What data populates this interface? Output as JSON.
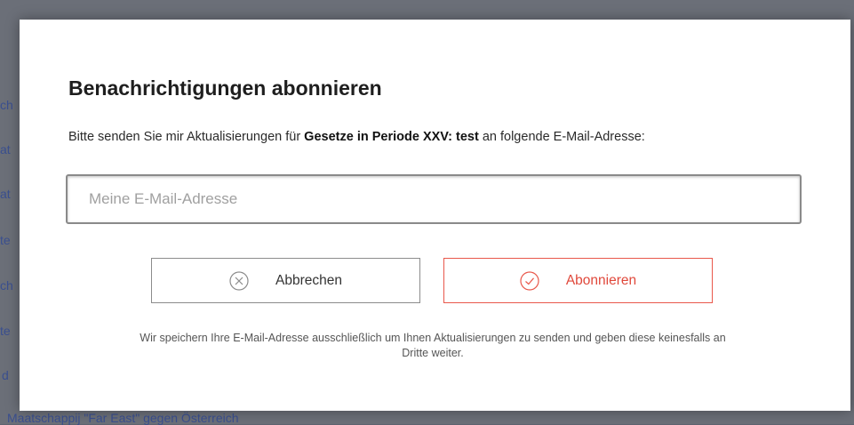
{
  "background": {
    "left_fragments": [
      "ch",
      "at",
      "at",
      "te",
      "ch",
      "te",
      "d"
    ],
    "bottom_link": "Maatschappij \"Far East\" gegen Österreich"
  },
  "modal": {
    "title": "Benachrichtigungen abonnieren",
    "intro_before": "Bitte senden Sie mir Aktualisierungen für ",
    "intro_bold": "Gesetze in Periode XXV: test",
    "intro_after": " an folgende E-Mail-Adresse:",
    "email_placeholder": "Meine E-Mail-Adresse",
    "email_value": "",
    "cancel_label": "Abbrechen",
    "cancel_icon": "circle-x-icon",
    "subscribe_label": "Abonnieren",
    "subscribe_icon": "circle-check-icon",
    "note": "Wir speichern Ihre E-Mail-Adresse ausschließlich um Ihnen Aktualisierungen zu senden und geben diese keinesfalls an Dritte weiter."
  },
  "colors": {
    "accent": "#e9584b",
    "overlay": "#6b6f78",
    "link": "#3a4f8f"
  }
}
